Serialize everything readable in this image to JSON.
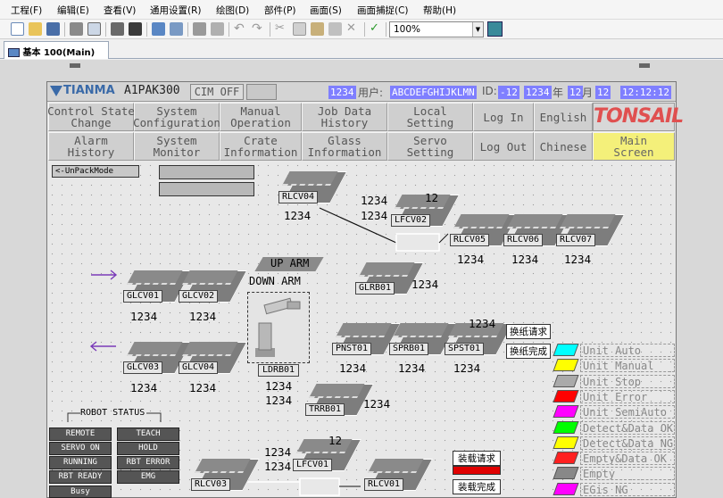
{
  "menubar": [
    "工程(F)",
    "编辑(E)",
    "查看(V)",
    "通用设置(R)",
    "绘图(D)",
    "部件(P)",
    "画面(S)",
    "画面捕捉(C)",
    "帮助(H)"
  ],
  "toolbar": {
    "zoom": "100%"
  },
  "tab": {
    "label": "基本 100(Main)"
  },
  "header": {
    "brand": "TIANMA",
    "model": "A1PAK300",
    "cim": "CIM OFF",
    "id_val": "1234",
    "user_label": "用户:",
    "user_val": "ABCDEFGHIJKLMN",
    "id_label": "ID:",
    "id_num": "-12",
    "year": "1234",
    "year_unit": "年",
    "month": "12",
    "month_unit": "月",
    "day": "12",
    "time": "12:12:12"
  },
  "nav": {
    "row1": [
      "Control State\nChange",
      "System\nConfiguration",
      "Manual\nOperation",
      "Job Data\nHistory",
      "Local\nSetting",
      "Log In",
      "English"
    ],
    "row2": [
      "Alarm\nHistory",
      "System\nMonitor",
      "Crate\nInformation",
      "Glass\nInformation",
      "Servo\nSetting",
      "Log Out",
      "Chinese",
      "Main\nScreen"
    ],
    "logo": "TONSAIL"
  },
  "mode_button": "<-UnPackMode",
  "units": {
    "rlcv04": "RLCV04",
    "lfcv02": "LFCV02",
    "rlcv05": "RLCV05",
    "rlcv06": "RLCV06",
    "rlcv07": "RLCV07",
    "glcv01": "GLCV01",
    "glcv02": "GLCV02",
    "glcv03": "GLCV03",
    "glcv04": "GLCV04",
    "glrb01": "GLRB01",
    "pnst01": "PNST01",
    "sprb01": "SPRB01",
    "spst01": "SPST01",
    "trrb01": "TRRB01",
    "lfcv01": "LFCV01",
    "rlcv03": "RLCV03",
    "rlcv01": "RLCV01",
    "ldrb01": "LDRB01"
  },
  "counter": "1234",
  "lfcv_small": "12",
  "arm": {
    "up": "UP ARM",
    "down": "DOWN ARM"
  },
  "paper": {
    "req": "换纸请求",
    "done": "换纸完成"
  },
  "load": {
    "req": "装载请求",
    "done": "装载完成"
  },
  "robot_status": {
    "title": "ROBOT STATUS",
    "items": [
      "REMOTE",
      "TEACH",
      "SERVO ON",
      "HOLD",
      "RUNNING",
      "RBT ERROR",
      "RBT READY",
      "EMG",
      "Busy"
    ]
  },
  "legend": [
    {
      "label": "Unit Auto",
      "color": "#00ffff"
    },
    {
      "label": "Unit Manual",
      "color": "#ffff00"
    },
    {
      "label": "Unit Stop",
      "color": "#aaaaaa"
    },
    {
      "label": "Unit Error",
      "color": "#ff0000"
    },
    {
      "label": "Unit SemiAuto",
      "color": "#ff00ff"
    },
    {
      "label": "Detect&Data OK",
      "color": "#00ff00"
    },
    {
      "label": "Detect&Data NG",
      "color": "#ffff00"
    },
    {
      "label": "Empty&Data OK",
      "color": "#ff2020"
    },
    {
      "label": "Empty",
      "color": "#888888"
    },
    {
      "label": "EGis NG",
      "color": "#ff00ff"
    }
  ]
}
